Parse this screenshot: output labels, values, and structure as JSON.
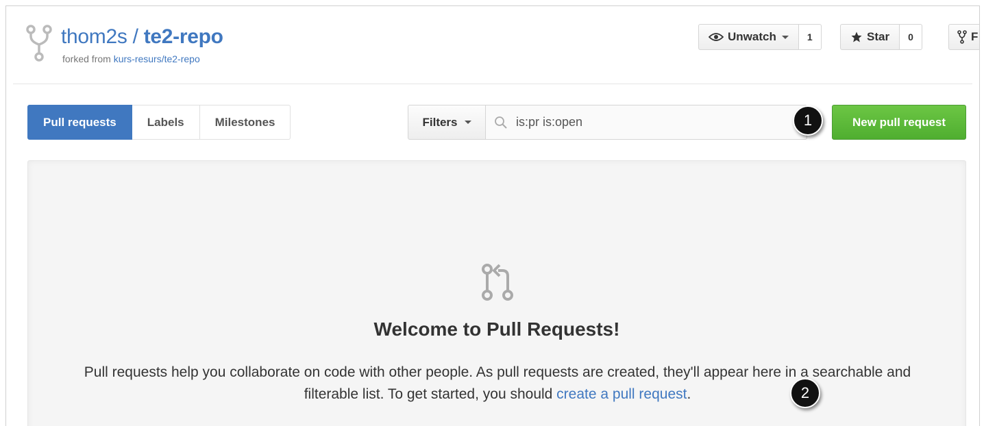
{
  "repo": {
    "owner": "thom2s",
    "separator": " / ",
    "name": "te2-repo",
    "forked_prefix": "forked from ",
    "forked_source": "kurs-resurs/te2-repo"
  },
  "actions": {
    "watch_label": "Unwatch",
    "watch_count": "1",
    "star_label": "Star",
    "star_count": "0",
    "fork_label": "F"
  },
  "subnav": {
    "items": [
      {
        "label": "Pull requests",
        "selected": true
      },
      {
        "label": "Labels"
      },
      {
        "label": "Milestones"
      }
    ]
  },
  "filters": {
    "label": "Filters",
    "search_value": "is:pr is:open"
  },
  "new_pr_label": "New pull request",
  "callouts": [
    "1",
    "2"
  ],
  "blankslate": {
    "title": "Welcome to Pull Requests!",
    "text_before": "Pull requests help you collaborate on code with other people. As pull requests are created, they'll appear here in a searchable and filterable list. To get started, you should ",
    "link": "create a pull request",
    "text_after": "."
  },
  "colors": {
    "link": "#4078c0",
    "selected_tab": "#4078c0",
    "new_pr_button": "#6cc644",
    "blankslate_bg": "#f5f5f5"
  },
  "icons": {
    "repo": "repo-forked-icon",
    "watch": "eye-icon",
    "star": "star-icon",
    "fork": "repo-forked-icon",
    "search": "search-icon",
    "blankslate": "git-pull-request-icon"
  }
}
